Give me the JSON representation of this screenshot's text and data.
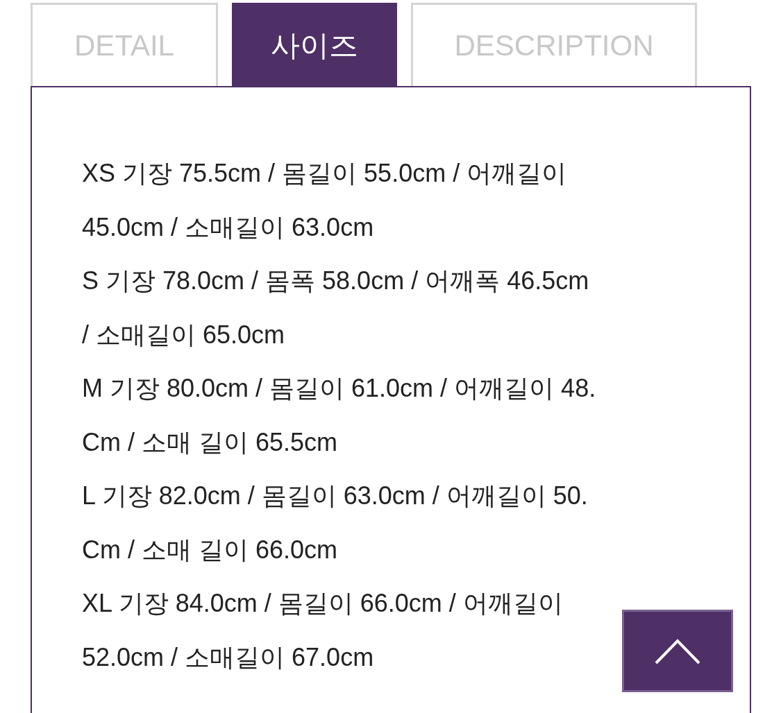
{
  "tabs": [
    {
      "label": "DETAIL",
      "selected": false
    },
    {
      "label": "사이즈",
      "selected": true
    },
    {
      "label": "DESCRIPTION",
      "selected": false
    }
  ],
  "size_lines": [
    "XS 기장 75.5cm / 몸길이 55.0cm / 어깨길이",
    "45.0cm / 소매길이 63.0cm",
    "S 기장 78.0cm / 몸폭 58.0cm / 어깨폭 46.5cm",
    "/ 소매길이 65.0cm",
    "M 기장 80.0cm / 몸길이 61.0cm / 어깨길이 48.",
    "Cm / 소매 길이 65.5cm",
    "L 기장 82.0cm / 몸길이 63.0cm / 어깨길이 50.",
    "Cm / 소매 길이 66.0cm",
    "XL 기장 84.0cm / 몸길이 66.0cm / 어깨길이",
    "52.0cm / 소매길이 67.0cm"
  ]
}
